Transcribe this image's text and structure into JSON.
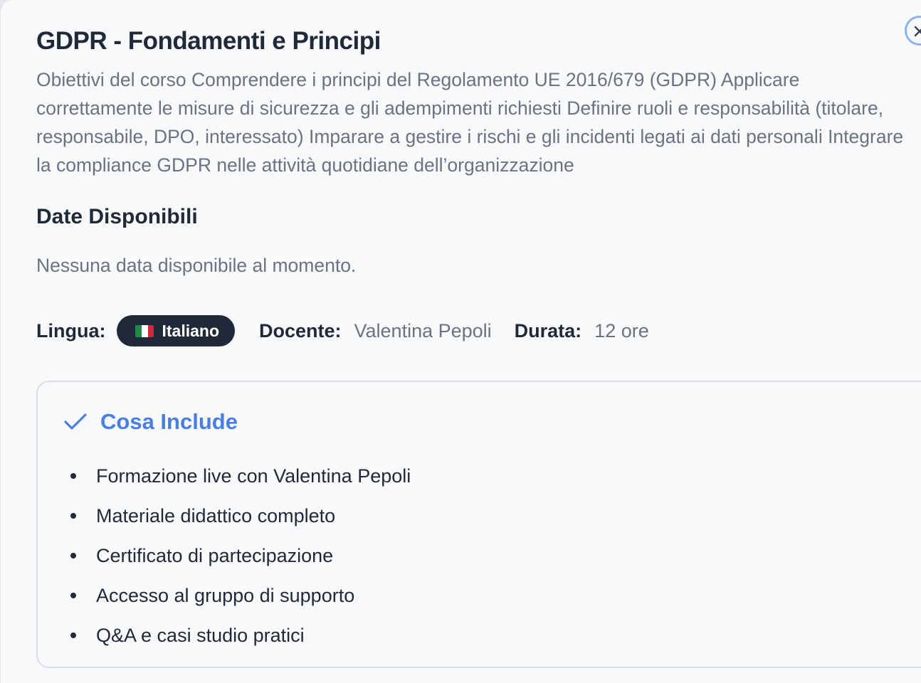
{
  "course": {
    "title": "GDPR - Fondamenti e Principi",
    "description": "Obiettivi del corso Comprendere i principi del Regolamento UE 2016/679 (GDPR) Applicare correttamente le misure di sicurezza e gli adempimenti richiesti Definire ruoli e responsabilità (titolare, responsabile, DPO, interessato) Imparare a gestire i rischi e gli incidenti legati ai dati personali Integrare la compliance GDPR nelle attività quotidiane dell’organizzazione"
  },
  "dates": {
    "title": "Date Disponibili",
    "empty_message": "Nessuna data disponibile al momento."
  },
  "meta": {
    "language_label": "Lingua:",
    "language_value": "Italiano",
    "language_flag_icon": "italy-flag-icon",
    "teacher_label": "Docente:",
    "teacher_value": "Valentina Pepoli",
    "duration_label": "Durata:",
    "duration_value": "12 ore"
  },
  "includes": {
    "title": "Cosa Include",
    "icon": "check-icon",
    "items": [
      "Formazione live con Valentina Pepoli",
      "Materiale didattico completo",
      "Certificato di partecipazione",
      "Accesso al gruppo di supporto",
      "Q&A e casi studio pratici"
    ]
  },
  "colors": {
    "accent": "#4a7fe0",
    "badge_bg": "#1f2937",
    "text_primary": "#1f2937",
    "text_muted": "#6b7280",
    "close_border": "#8fb2ef"
  },
  "icons": {
    "close": "close-icon"
  }
}
